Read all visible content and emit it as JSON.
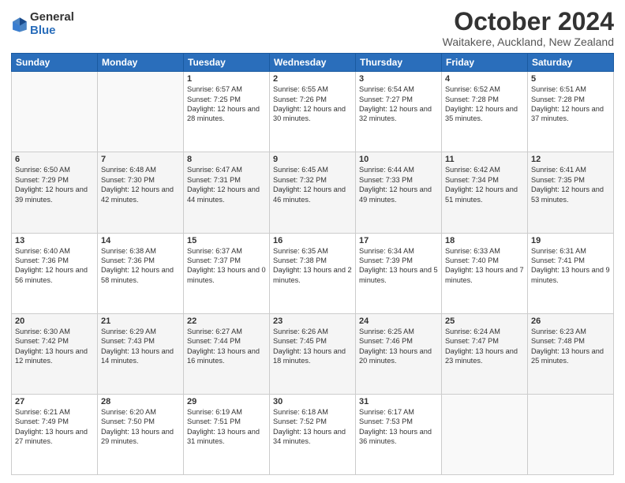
{
  "header": {
    "logo_general": "General",
    "logo_blue": "Blue",
    "month_title": "October 2024",
    "location": "Waitakere, Auckland, New Zealand"
  },
  "weekdays": [
    "Sunday",
    "Monday",
    "Tuesday",
    "Wednesday",
    "Thursday",
    "Friday",
    "Saturday"
  ],
  "weeks": [
    [
      {
        "day": "",
        "sunrise": "",
        "sunset": "",
        "daylight": ""
      },
      {
        "day": "",
        "sunrise": "",
        "sunset": "",
        "daylight": ""
      },
      {
        "day": "1",
        "sunrise": "Sunrise: 6:57 AM",
        "sunset": "Sunset: 7:25 PM",
        "daylight": "Daylight: 12 hours and 28 minutes."
      },
      {
        "day": "2",
        "sunrise": "Sunrise: 6:55 AM",
        "sunset": "Sunset: 7:26 PM",
        "daylight": "Daylight: 12 hours and 30 minutes."
      },
      {
        "day": "3",
        "sunrise": "Sunrise: 6:54 AM",
        "sunset": "Sunset: 7:27 PM",
        "daylight": "Daylight: 12 hours and 32 minutes."
      },
      {
        "day": "4",
        "sunrise": "Sunrise: 6:52 AM",
        "sunset": "Sunset: 7:28 PM",
        "daylight": "Daylight: 12 hours and 35 minutes."
      },
      {
        "day": "5",
        "sunrise": "Sunrise: 6:51 AM",
        "sunset": "Sunset: 7:28 PM",
        "daylight": "Daylight: 12 hours and 37 minutes."
      }
    ],
    [
      {
        "day": "6",
        "sunrise": "Sunrise: 6:50 AM",
        "sunset": "Sunset: 7:29 PM",
        "daylight": "Daylight: 12 hours and 39 minutes."
      },
      {
        "day": "7",
        "sunrise": "Sunrise: 6:48 AM",
        "sunset": "Sunset: 7:30 PM",
        "daylight": "Daylight: 12 hours and 42 minutes."
      },
      {
        "day": "8",
        "sunrise": "Sunrise: 6:47 AM",
        "sunset": "Sunset: 7:31 PM",
        "daylight": "Daylight: 12 hours and 44 minutes."
      },
      {
        "day": "9",
        "sunrise": "Sunrise: 6:45 AM",
        "sunset": "Sunset: 7:32 PM",
        "daylight": "Daylight: 12 hours and 46 minutes."
      },
      {
        "day": "10",
        "sunrise": "Sunrise: 6:44 AM",
        "sunset": "Sunset: 7:33 PM",
        "daylight": "Daylight: 12 hours and 49 minutes."
      },
      {
        "day": "11",
        "sunrise": "Sunrise: 6:42 AM",
        "sunset": "Sunset: 7:34 PM",
        "daylight": "Daylight: 12 hours and 51 minutes."
      },
      {
        "day": "12",
        "sunrise": "Sunrise: 6:41 AM",
        "sunset": "Sunset: 7:35 PM",
        "daylight": "Daylight: 12 hours and 53 minutes."
      }
    ],
    [
      {
        "day": "13",
        "sunrise": "Sunrise: 6:40 AM",
        "sunset": "Sunset: 7:36 PM",
        "daylight": "Daylight: 12 hours and 56 minutes."
      },
      {
        "day": "14",
        "sunrise": "Sunrise: 6:38 AM",
        "sunset": "Sunset: 7:36 PM",
        "daylight": "Daylight: 12 hours and 58 minutes."
      },
      {
        "day": "15",
        "sunrise": "Sunrise: 6:37 AM",
        "sunset": "Sunset: 7:37 PM",
        "daylight": "Daylight: 13 hours and 0 minutes."
      },
      {
        "day": "16",
        "sunrise": "Sunrise: 6:35 AM",
        "sunset": "Sunset: 7:38 PM",
        "daylight": "Daylight: 13 hours and 2 minutes."
      },
      {
        "day": "17",
        "sunrise": "Sunrise: 6:34 AM",
        "sunset": "Sunset: 7:39 PM",
        "daylight": "Daylight: 13 hours and 5 minutes."
      },
      {
        "day": "18",
        "sunrise": "Sunrise: 6:33 AM",
        "sunset": "Sunset: 7:40 PM",
        "daylight": "Daylight: 13 hours and 7 minutes."
      },
      {
        "day": "19",
        "sunrise": "Sunrise: 6:31 AM",
        "sunset": "Sunset: 7:41 PM",
        "daylight": "Daylight: 13 hours and 9 minutes."
      }
    ],
    [
      {
        "day": "20",
        "sunrise": "Sunrise: 6:30 AM",
        "sunset": "Sunset: 7:42 PM",
        "daylight": "Daylight: 13 hours and 12 minutes."
      },
      {
        "day": "21",
        "sunrise": "Sunrise: 6:29 AM",
        "sunset": "Sunset: 7:43 PM",
        "daylight": "Daylight: 13 hours and 14 minutes."
      },
      {
        "day": "22",
        "sunrise": "Sunrise: 6:27 AM",
        "sunset": "Sunset: 7:44 PM",
        "daylight": "Daylight: 13 hours and 16 minutes."
      },
      {
        "day": "23",
        "sunrise": "Sunrise: 6:26 AM",
        "sunset": "Sunset: 7:45 PM",
        "daylight": "Daylight: 13 hours and 18 minutes."
      },
      {
        "day": "24",
        "sunrise": "Sunrise: 6:25 AM",
        "sunset": "Sunset: 7:46 PM",
        "daylight": "Daylight: 13 hours and 20 minutes."
      },
      {
        "day": "25",
        "sunrise": "Sunrise: 6:24 AM",
        "sunset": "Sunset: 7:47 PM",
        "daylight": "Daylight: 13 hours and 23 minutes."
      },
      {
        "day": "26",
        "sunrise": "Sunrise: 6:23 AM",
        "sunset": "Sunset: 7:48 PM",
        "daylight": "Daylight: 13 hours and 25 minutes."
      }
    ],
    [
      {
        "day": "27",
        "sunrise": "Sunrise: 6:21 AM",
        "sunset": "Sunset: 7:49 PM",
        "daylight": "Daylight: 13 hours and 27 minutes."
      },
      {
        "day": "28",
        "sunrise": "Sunrise: 6:20 AM",
        "sunset": "Sunset: 7:50 PM",
        "daylight": "Daylight: 13 hours and 29 minutes."
      },
      {
        "day": "29",
        "sunrise": "Sunrise: 6:19 AM",
        "sunset": "Sunset: 7:51 PM",
        "daylight": "Daylight: 13 hours and 31 minutes."
      },
      {
        "day": "30",
        "sunrise": "Sunrise: 6:18 AM",
        "sunset": "Sunset: 7:52 PM",
        "daylight": "Daylight: 13 hours and 34 minutes."
      },
      {
        "day": "31",
        "sunrise": "Sunrise: 6:17 AM",
        "sunset": "Sunset: 7:53 PM",
        "daylight": "Daylight: 13 hours and 36 minutes."
      },
      {
        "day": "",
        "sunrise": "",
        "sunset": "",
        "daylight": ""
      },
      {
        "day": "",
        "sunrise": "",
        "sunset": "",
        "daylight": ""
      }
    ]
  ]
}
